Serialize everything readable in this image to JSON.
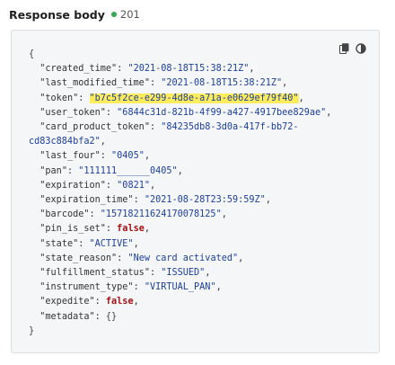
{
  "header": {
    "title": "Response body",
    "status_code": "201"
  },
  "colors": {
    "status_dot": "#35a853",
    "highlight": "#ffec5c",
    "string": "#1c3fa0",
    "keyword": "#a40e12"
  },
  "toolbar": {
    "icons": [
      "copy-icon",
      "contrast-icon"
    ]
  },
  "code": {
    "open_brace": "{",
    "close_brace": "}",
    "lines": [
      {
        "key": "\"created_time\"",
        "value": "\"2021-08-18T15:38:21Z\"",
        "type": "string"
      },
      {
        "key": "\"last_modified_time\"",
        "value": "\"2021-08-18T15:38:21Z\"",
        "type": "string"
      },
      {
        "key": "\"token\"",
        "value": "\"b7c5f2ce-e299-4d8e-a71a-e0629ef79f40\"",
        "type": "string",
        "highlight": true
      },
      {
        "key": "\"user_token\"",
        "value": "\"6844c31d-821b-4f99-a427-4917bee829ae\"",
        "type": "string"
      },
      {
        "key": "\"card_product_token\"",
        "value": "\"84235db8-3d0a-417f-bb72-",
        "type": "string",
        "continuation": "cd83c884bfa2\""
      },
      {
        "key": "\"last_four\"",
        "value": "\"0405\"",
        "type": "string"
      },
      {
        "key": "\"pan\"",
        "value": "\"111111______0405\"",
        "type": "string"
      },
      {
        "key": "\"expiration\"",
        "value": "\"0821\"",
        "type": "string"
      },
      {
        "key": "\"expiration_time\"",
        "value": "\"2021-08-28T23:59:59Z\"",
        "type": "string"
      },
      {
        "key": "\"barcode\"",
        "value": "\"15718211624170078125\"",
        "type": "string"
      },
      {
        "key": "\"pin_is_set\"",
        "value": "false",
        "type": "keyword"
      },
      {
        "key": "\"state\"",
        "value": "\"ACTIVE\"",
        "type": "string"
      },
      {
        "key": "\"state_reason\"",
        "value": "\"New card activated\"",
        "type": "string"
      },
      {
        "key": "\"fulfillment_status\"",
        "value": "\"ISSUED\"",
        "type": "string"
      },
      {
        "key": "\"instrument_type\"",
        "value": "\"VIRTUAL_PAN\"",
        "type": "string"
      },
      {
        "key": "\"expedite\"",
        "value": "false",
        "type": "keyword"
      },
      {
        "key": "\"metadata\"",
        "value": "{}",
        "type": "plain",
        "last": true
      }
    ]
  }
}
